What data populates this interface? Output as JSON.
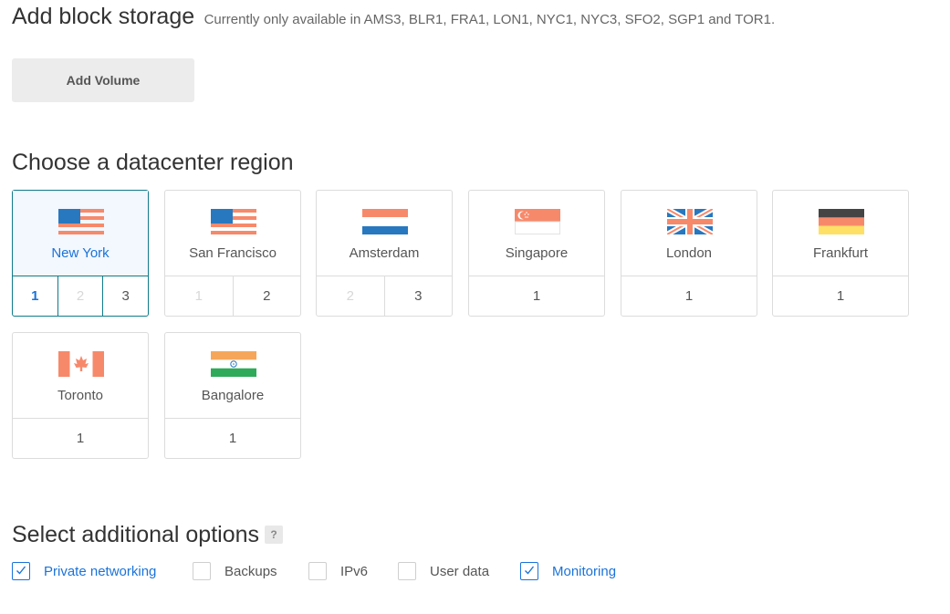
{
  "header": {
    "title": "Add block storage",
    "subtitle": "Currently only available in AMS3, BLR1, FRA1, LON1, NYC1, NYC3, SFO2, SGP1 and TOR1."
  },
  "add_volume_label": "Add Volume",
  "region_section_title": "Choose a datacenter region",
  "regions": [
    {
      "name": "New York",
      "flag": "us-flag-icon",
      "selected": true,
      "numbers": [
        {
          "label": "1",
          "state": "active"
        },
        {
          "label": "2",
          "state": "disabled"
        },
        {
          "label": "3",
          "state": "normal"
        }
      ]
    },
    {
      "name": "San Francisco",
      "flag": "us-flag-icon",
      "selected": false,
      "numbers": [
        {
          "label": "1",
          "state": "disabled"
        },
        {
          "label": "2",
          "state": "normal"
        }
      ]
    },
    {
      "name": "Amsterdam",
      "flag": "netherlands-flag-icon",
      "selected": false,
      "numbers": [
        {
          "label": "2",
          "state": "disabled"
        },
        {
          "label": "3",
          "state": "normal"
        }
      ]
    },
    {
      "name": "Singapore",
      "flag": "singapore-flag-icon",
      "selected": false,
      "numbers": [
        {
          "label": "1",
          "state": "normal"
        }
      ]
    },
    {
      "name": "London",
      "flag": "uk-flag-icon",
      "selected": false,
      "numbers": [
        {
          "label": "1",
          "state": "normal"
        }
      ]
    },
    {
      "name": "Frankfurt",
      "flag": "germany-flag-icon",
      "selected": false,
      "numbers": [
        {
          "label": "1",
          "state": "normal"
        }
      ]
    },
    {
      "name": "Toronto",
      "flag": "canada-flag-icon",
      "selected": false,
      "numbers": [
        {
          "label": "1",
          "state": "normal"
        }
      ]
    },
    {
      "name": "Bangalore",
      "flag": "india-flag-icon",
      "selected": false,
      "numbers": [
        {
          "label": "1",
          "state": "normal"
        }
      ]
    }
  ],
  "options_section_title": "Select additional options",
  "help_icon_label": "?",
  "options": [
    {
      "label": "Private networking",
      "checked": true
    },
    {
      "label": "Backups",
      "checked": false
    },
    {
      "label": "IPv6",
      "checked": false
    },
    {
      "label": "User data",
      "checked": false
    },
    {
      "label": "Monitoring",
      "checked": true
    }
  ],
  "colors": {
    "accent": "#1a73d9",
    "selected_border": "#0f7b8a",
    "selected_bg": "#f3f7fe",
    "flag_blue": "#2878c0",
    "flag_salmon": "#f7896b"
  }
}
